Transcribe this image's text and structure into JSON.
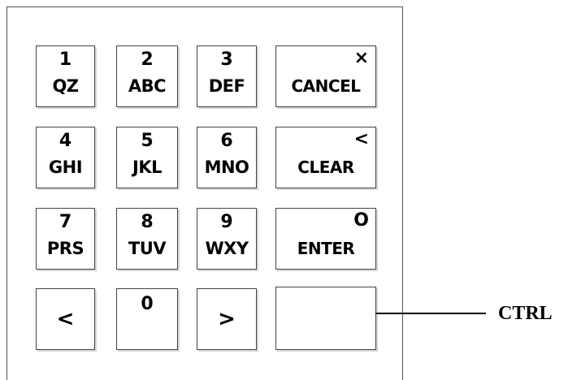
{
  "keypad": {
    "row1": [
      {
        "number": "1",
        "letters": "QZ"
      },
      {
        "number": "2",
        "letters": "ABC"
      },
      {
        "number": "3",
        "letters": "DEF"
      }
    ],
    "row2": [
      {
        "number": "4",
        "letters": "GHI"
      },
      {
        "number": "5",
        "letters": "JKL"
      },
      {
        "number": "6",
        "letters": "MNO"
      }
    ],
    "row3": [
      {
        "number": "7",
        "letters": "PRS"
      },
      {
        "number": "8",
        "letters": "TUV"
      },
      {
        "number": "9",
        "letters": "WXY"
      }
    ],
    "row4": {
      "left_arrow": "<",
      "zero": "0",
      "right_arrow": ">"
    },
    "function_keys": {
      "cancel": {
        "symbol": "×",
        "label": "CANCEL"
      },
      "clear": {
        "symbol": "<",
        "label": "CLEAR"
      },
      "enter": {
        "symbol": "O",
        "label": "ENTER"
      },
      "ctrl": {
        "symbol": "",
        "label": ""
      }
    }
  },
  "callout": {
    "label": "CTRL"
  }
}
